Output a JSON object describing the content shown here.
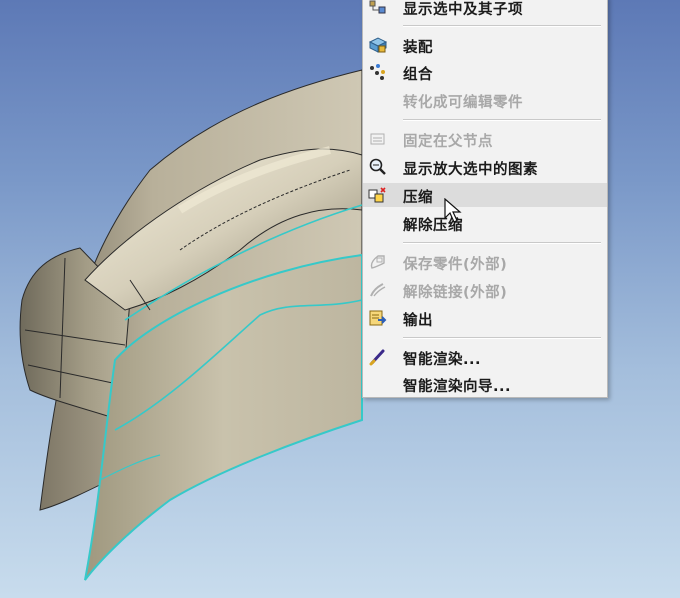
{
  "colors": {
    "surface_fill": "#c7bfa9",
    "surface_dark": "#8f8873",
    "edge_highlight": "#36c9c9",
    "menu_bg": "#f2f2f2",
    "menu_hover": "#dcdcdc",
    "disabled_text": "#a8a8a8"
  },
  "context_menu": {
    "items": [
      {
        "label": "显示选中及其子项",
        "icon": "tree-children-icon",
        "disabled": false
      },
      {
        "label": "装配",
        "icon": "assembly-icon",
        "disabled": false
      },
      {
        "label": "组合",
        "icon": "group-icon",
        "disabled": false
      },
      {
        "label": "转化成可编辑零件",
        "icon": "",
        "disabled": true
      },
      {
        "label": "固定在父节点",
        "icon": "pin-parent-icon",
        "disabled": true
      },
      {
        "label": "显示放大选中的图素",
        "icon": "zoom-selected-icon",
        "disabled": false
      },
      {
        "label": "压缩",
        "icon": "suppress-icon",
        "disabled": false,
        "hover": true
      },
      {
        "label": "解除压缩",
        "icon": "",
        "disabled": false
      },
      {
        "label": "保存零件(外部)",
        "icon": "save-part-icon",
        "disabled": true
      },
      {
        "label": "解除链接(外部)",
        "icon": "unlink-icon",
        "disabled": true
      },
      {
        "label": "输出",
        "icon": "export-icon",
        "disabled": false
      },
      {
        "label": "智能渲染...",
        "icon": "render-brush-icon",
        "disabled": false
      },
      {
        "label": "智能渲染向导...",
        "icon": "",
        "disabled": false
      }
    ]
  }
}
